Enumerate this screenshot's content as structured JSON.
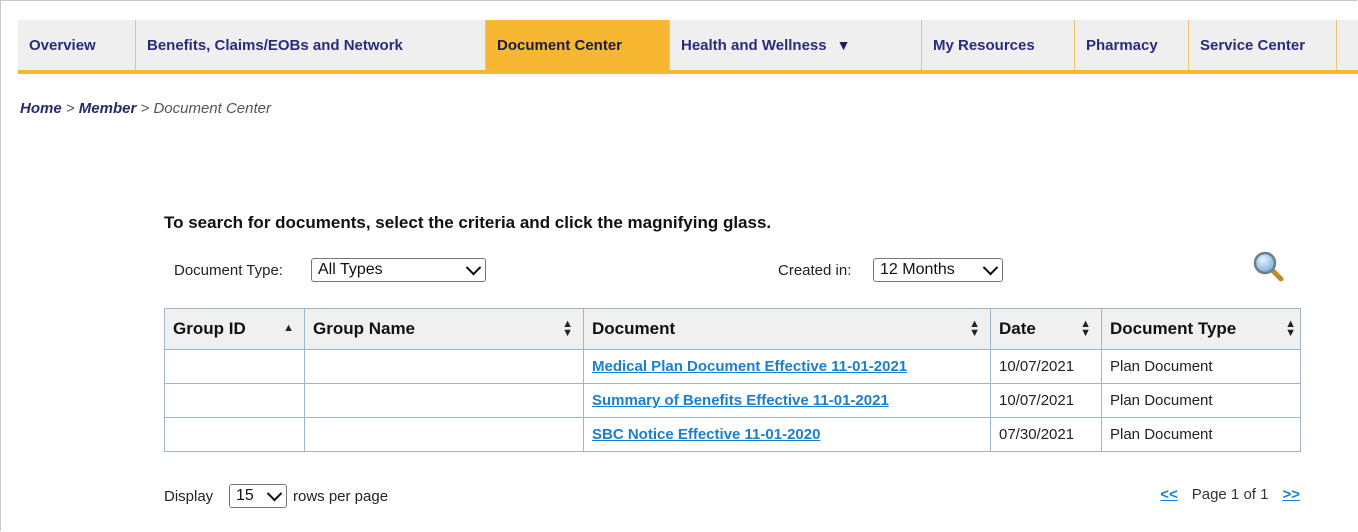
{
  "nav": {
    "items": [
      {
        "label": "Overview"
      },
      {
        "label": "Benefits, Claims/EOBs and Network"
      },
      {
        "label": "Document Center"
      },
      {
        "label": "Health and Wellness"
      },
      {
        "label": "My Resources"
      },
      {
        "label": "Pharmacy"
      },
      {
        "label": "Service Center"
      }
    ],
    "dropdown_icon": "triangle-down-icon",
    "active_color": "#f7b733"
  },
  "breadcrumb": {
    "home": "Home",
    "sep1": " > ",
    "member": "Member",
    "sep2": " > ",
    "current": "Document Center"
  },
  "search": {
    "instruction": "To search for documents, select the criteria and click the magnifying glass.",
    "doc_type_label": "Document Type:",
    "doc_type_value": "All Types",
    "created_label": "Created in:",
    "created_value": "12 Months",
    "search_icon": "magnifying-glass-icon"
  },
  "table": {
    "headers": [
      "Group ID",
      "Group Name",
      "Document",
      "Date",
      "Document Type"
    ],
    "rows": [
      {
        "group_id": "",
        "group_name": "",
        "document": "Medical Plan Document Effective 11-01-2021",
        "date": "10/07/2021",
        "type": "Plan Document"
      },
      {
        "group_id": "",
        "group_name": "",
        "document": "Summary of Benefits Effective 11-01-2021",
        "date": "10/07/2021",
        "type": "Plan Document"
      },
      {
        "group_id": "",
        "group_name": "",
        "document": "SBC Notice Effective 11-01-2020",
        "date": "07/30/2021",
        "type": "Plan Document"
      }
    ]
  },
  "footer": {
    "display_label": "Display",
    "rows_value": "15",
    "rows_suffix": "rows per page",
    "prev": "<<",
    "page_text": "Page 1 of 1",
    "next": ">>"
  }
}
